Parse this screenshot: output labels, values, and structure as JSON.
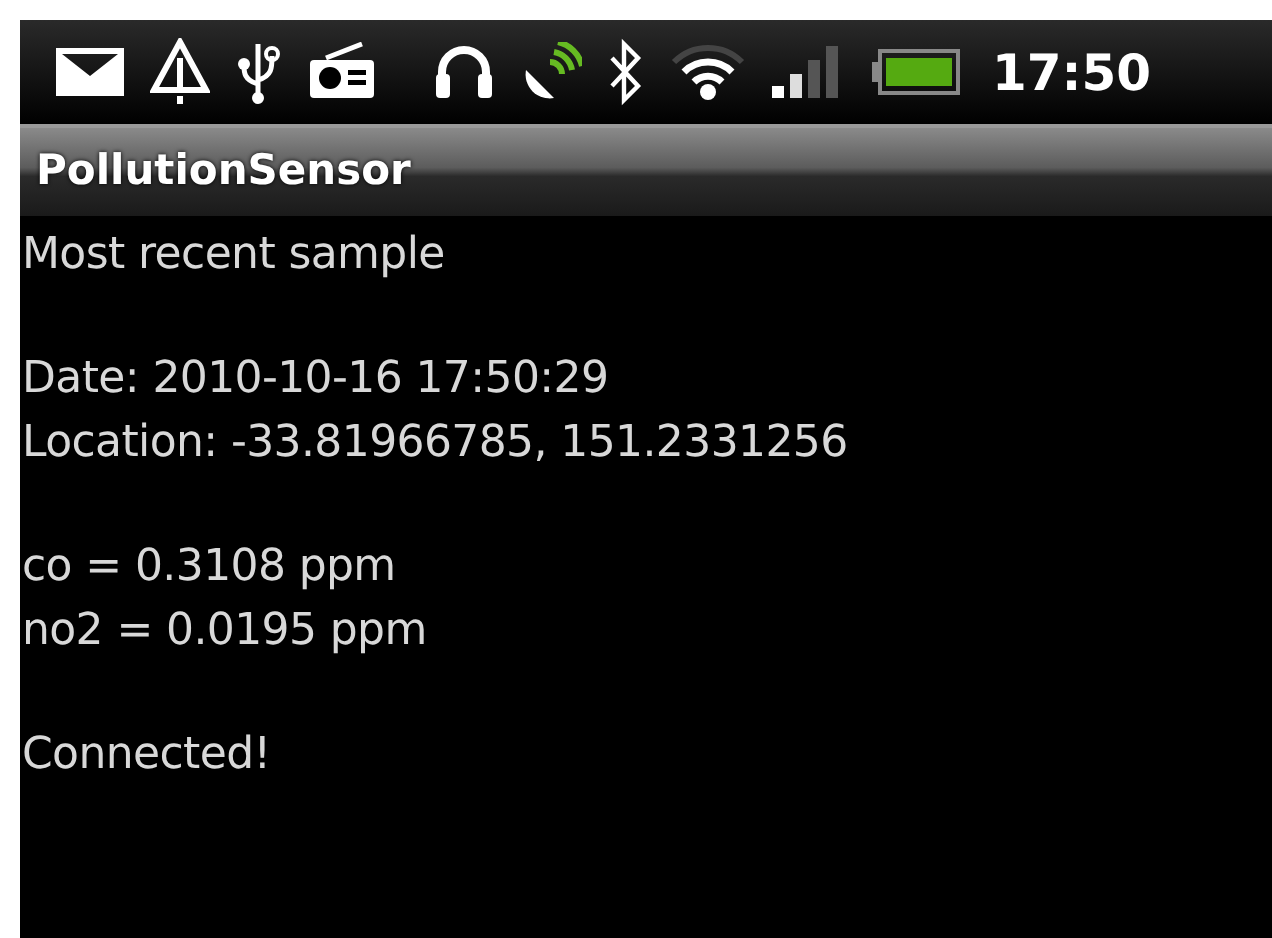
{
  "status_bar": {
    "time": "17:50"
  },
  "title_bar": {
    "title": "PollutionSensor"
  },
  "paragraphs": [
    [
      "Most recent sample"
    ],
    [
      "Date: 2010-10-16 17:50:29",
      "Location: -33.81966785, 151.2331256"
    ],
    [
      "co = 0.3108 ppm",
      "no2 = 0.0195 ppm"
    ],
    [
      "Connected!"
    ]
  ]
}
